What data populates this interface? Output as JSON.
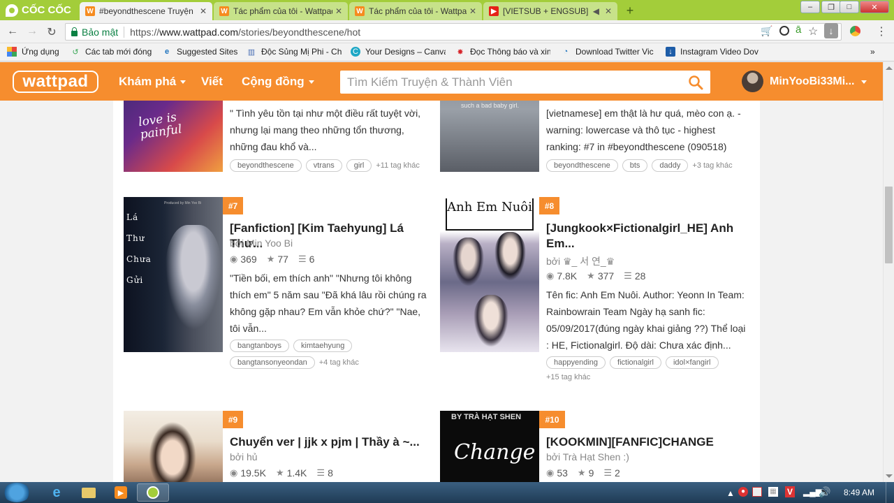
{
  "browser": {
    "brand": "CỐC CỐC",
    "tabs": [
      {
        "title": "#beyondthescene Truyện",
        "icon": "wattpad",
        "active": true
      },
      {
        "title": "Tác phẩm của tôi - Wattpad",
        "icon": "wattpad",
        "active": false
      },
      {
        "title": "Tác phẩm của tôi - Wattpad",
        "icon": "wattpad",
        "active": false
      },
      {
        "title": "[VIETSUB + ENGSUB] B",
        "icon": "youtube",
        "active": false
      }
    ],
    "security_label": "Bảo mật",
    "url_scheme": "https://",
    "url_host": "www.wattpad.com",
    "url_path": "/stories/beyondthescene/hot",
    "bookmarks": [
      {
        "label": "Ứng dụng",
        "icon": "apps-grid-icon"
      },
      {
        "label": "Các tab mới đóng",
        "icon": "history-icon"
      },
      {
        "label": "Suggested Sites",
        "icon": "ie-icon"
      },
      {
        "label": "Độc Sủng Mị Phi - Ch",
        "icon": "book-icon"
      },
      {
        "label": "Your Designs – Canva",
        "icon": "canva-icon"
      },
      {
        "label": "Đọc Thông báo và xin",
        "icon": "star-icon"
      },
      {
        "label": "Download Twitter Vic",
        "icon": "download-icon"
      },
      {
        "label": "Instagram Video Dov",
        "icon": "instagram-icon"
      }
    ],
    "bookmarks_overflow": "»"
  },
  "wattpad": {
    "logo": "wattpad",
    "nav": [
      {
        "label": "Khám phá",
        "dropdown": true
      },
      {
        "label": "Viết",
        "dropdown": false
      },
      {
        "label": "Cộng đồng",
        "dropdown": true
      }
    ],
    "search_placeholder": "Tìm Kiếm Truyện & Thành Viên",
    "username": "MinYooBi33Mi..."
  },
  "stories": [
    {
      "rank": "",
      "title": "",
      "author": "",
      "description": "\" Tình yêu tồn tại như một điều rất tuyệt vời, nhưng lại mang theo những tổn thương, những đau khổ và...",
      "tags": [
        "beyondthescene",
        "vtrans",
        "girl"
      ],
      "more_tags": "+11 tag khác",
      "cover_text": "love is painful"
    },
    {
      "rank": "",
      "title": "",
      "author": "",
      "description": "[vietnamese] em thật là hư quá, mèo con ạ. - warning: lowercase và thô tục - highest ranking: #7 in #beyondthescene (090518)",
      "tags": [
        "beyondthescene",
        "bts",
        "daddy"
      ],
      "more_tags": "+3 tag khác",
      "cover_text": "such a bad baby girl."
    },
    {
      "rank": "#7",
      "title": "[Fanfiction] [Kim Taehyung] Lá Thư...",
      "author": "bởi Min Yoo Bi",
      "reads": "369",
      "votes": "77",
      "parts": "6",
      "description": "\"Tiền bối, em thích anh\" \"Nhưng tôi không thích em\" 5 năm sau \"Đã khá lâu rồi chúng ra không gặp nhau? Em vẫn khỏe chứ?\" \"Nae, tôi vẫn...",
      "tags": [
        "bangtanboys",
        "kimtaehyung",
        "bangtansonyeondan"
      ],
      "more_tags": "+4 tag khác",
      "cover_text": "Lá Thư Chưa Gửi",
      "cover_credit": "Produced by Min Yoo Bi"
    },
    {
      "rank": "#8",
      "title": "[Jungkook×Fictionalgirl_HE] Anh Em...",
      "author": "bởi ♛_ 서 연_♛",
      "reads": "7.8K",
      "votes": "377",
      "parts": "28",
      "description": "Tên fic: Anh Em Nuôi. Author: Yeonn In Team: Rainbowrain Team Ngày hạ sanh fic: 05/09/2017(đúng ngày khai giảng ??) Thể loại : HE, Fictionalgirl. Độ dài: Chưa xác định...",
      "tags": [
        "happyending",
        "fictionalgirl",
        "idol×fangirl"
      ],
      "more_tags": "+15 tag khác",
      "cover_text": "Anh Em Nuôi"
    },
    {
      "rank": "#9",
      "title": "Chuyển ver | jjk x pjm | Thầy à ~...",
      "author": "bởi hủ",
      "reads": "19.5K",
      "votes": "1.4K",
      "parts": "8"
    },
    {
      "rank": "#10",
      "title": "[KOOKMIN][FANFIC]CHANGE",
      "author": "bởi Trà Hạt Shen :)",
      "reads": "53",
      "votes": "9",
      "parts": "2",
      "cover_text": "Change",
      "cover_credit": "BY TRÀ HẠT SHEN"
    }
  ],
  "taskbar": {
    "clock": "8:49 AM"
  }
}
